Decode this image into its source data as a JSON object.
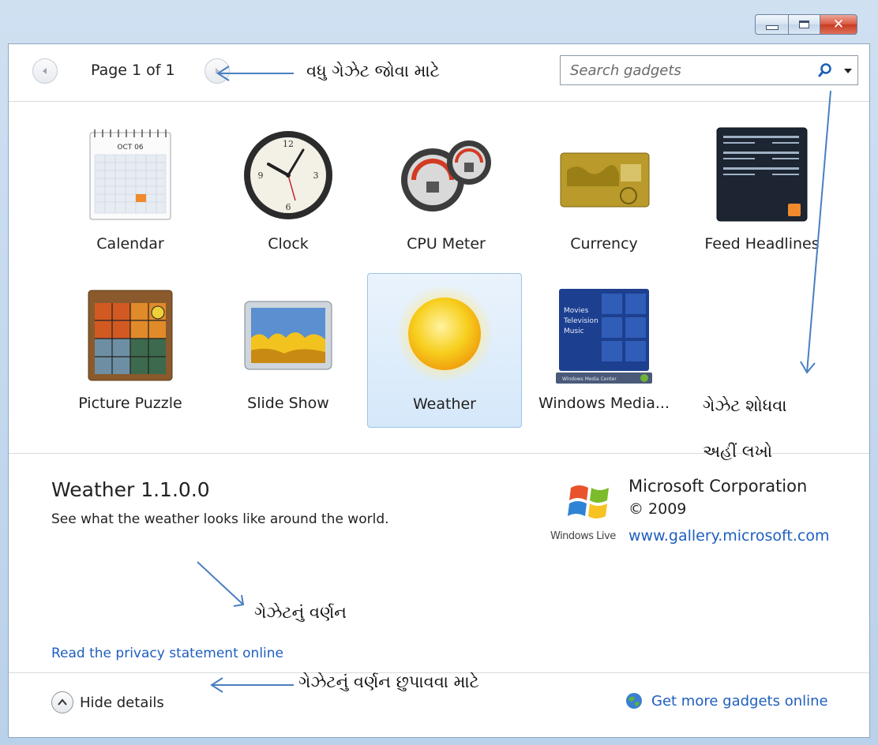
{
  "window": {
    "buttons": {
      "minimize": "minimize",
      "maximize": "maximize",
      "close": "✕"
    }
  },
  "toolbar": {
    "page_label": "Page 1 of 1",
    "search_placeholder": "Search gadgets"
  },
  "gadgets": [
    {
      "name": "Calendar",
      "icon": "calendar-icon",
      "selected": false
    },
    {
      "name": "Clock",
      "icon": "clock-icon",
      "selected": false
    },
    {
      "name": "CPU Meter",
      "icon": "cpu-meter-icon",
      "selected": false
    },
    {
      "name": "Currency",
      "icon": "currency-icon",
      "selected": false
    },
    {
      "name": "Feed Headlines",
      "icon": "feed-headlines-icon",
      "selected": false
    },
    {
      "name": "Picture Puzzle",
      "icon": "picture-puzzle-icon",
      "selected": false
    },
    {
      "name": "Slide Show",
      "icon": "slide-show-icon",
      "selected": false
    },
    {
      "name": "Weather",
      "icon": "weather-sun-icon",
      "selected": true
    },
    {
      "name": "Windows Media...",
      "icon": "windows-media-center-icon",
      "selected": false
    }
  ],
  "calendar_thumb": {
    "month": "OCT 06"
  },
  "media_thumb": {
    "menu": [
      "Movies",
      "Television",
      "Music"
    ],
    "footer": "Windows Media Center"
  },
  "details": {
    "title": "Weather 1.1.0.0",
    "description": "See what the weather looks like around the world.",
    "vendor": "Microsoft Corporation",
    "copyright": "© 2009",
    "brand_label": "Windows Live",
    "vendor_link": "www.gallery.microsoft.com",
    "privacy_link": "Read the privacy statement online"
  },
  "bottom_bar": {
    "hide_details": "Hide details",
    "more_gadgets": "Get more gadgets online"
  },
  "annotations": {
    "more_gadgets": "વધુ ગેઝેટ જોવા માટે",
    "search_line1": "ગેઝેટ શોધવા",
    "search_line2": "અહીં લખો",
    "description": "ગેઝેટનું વર્ણન",
    "hide_description": "ગેઝેટનું વર્ણન છુપાવવા માટે"
  },
  "colors": {
    "link": "#1f5fbf",
    "selection_bg": "#d5e8fa",
    "close_button": "#d9563e",
    "annotation_arrow": "#4a7fc0"
  }
}
